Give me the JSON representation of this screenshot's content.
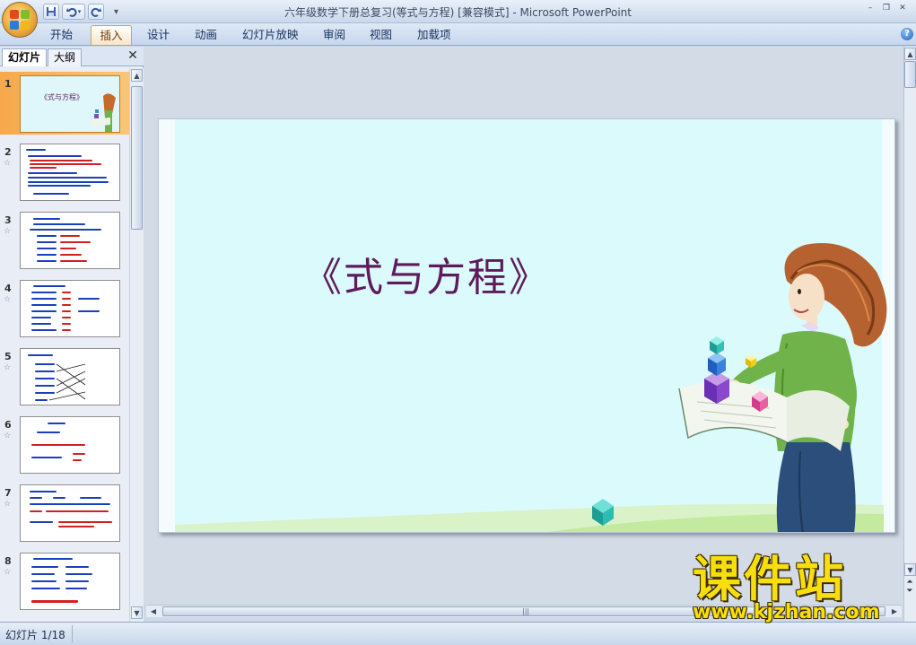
{
  "window": {
    "title": "六年级数学下册总复习(等式与方程) [兼容模式] - Microsoft PowerPoint",
    "controls": [
      "–",
      "❐",
      "✕"
    ]
  },
  "quick_access": {
    "save_icon": "save-icon",
    "undo_icon": "undo-icon",
    "redo_icon": "redo-icon",
    "customize_icon": "customize-qat-icon"
  },
  "ribbon": {
    "tabs": [
      {
        "label": "开始",
        "active": false
      },
      {
        "label": "插入",
        "active": true
      },
      {
        "label": "设计",
        "active": false
      },
      {
        "label": "动画",
        "active": false
      },
      {
        "label": "幻灯片放映",
        "active": false
      },
      {
        "label": "审阅",
        "active": false
      },
      {
        "label": "视图",
        "active": false
      },
      {
        "label": "加载项",
        "active": false
      }
    ],
    "help_label": "?"
  },
  "left_pane": {
    "tabs": [
      {
        "label": "幻灯片",
        "active": true
      },
      {
        "label": "大纲",
        "active": false
      }
    ],
    "close_label": "✕",
    "thumbnails": [
      {
        "number": "1",
        "selected": true,
        "star": false
      },
      {
        "number": "2",
        "selected": false,
        "star": true
      },
      {
        "number": "3",
        "selected": false,
        "star": true
      },
      {
        "number": "4",
        "selected": false,
        "star": true
      },
      {
        "number": "5",
        "selected": false,
        "star": true
      },
      {
        "number": "6",
        "selected": false,
        "star": true
      },
      {
        "number": "7",
        "selected": false,
        "star": true
      },
      {
        "number": "8",
        "selected": false,
        "star": true
      }
    ],
    "thumb1_title": "《式与方程》",
    "star_glyph": "☆"
  },
  "slide": {
    "title": "《式与方程》",
    "background": "#dbfafc",
    "title_color": "#5e1a5a"
  },
  "status": {
    "slide_indicator": "幻灯片 1/18"
  },
  "watermark": {
    "chinese": "课件站",
    "url": "www.kjzhan.com"
  }
}
